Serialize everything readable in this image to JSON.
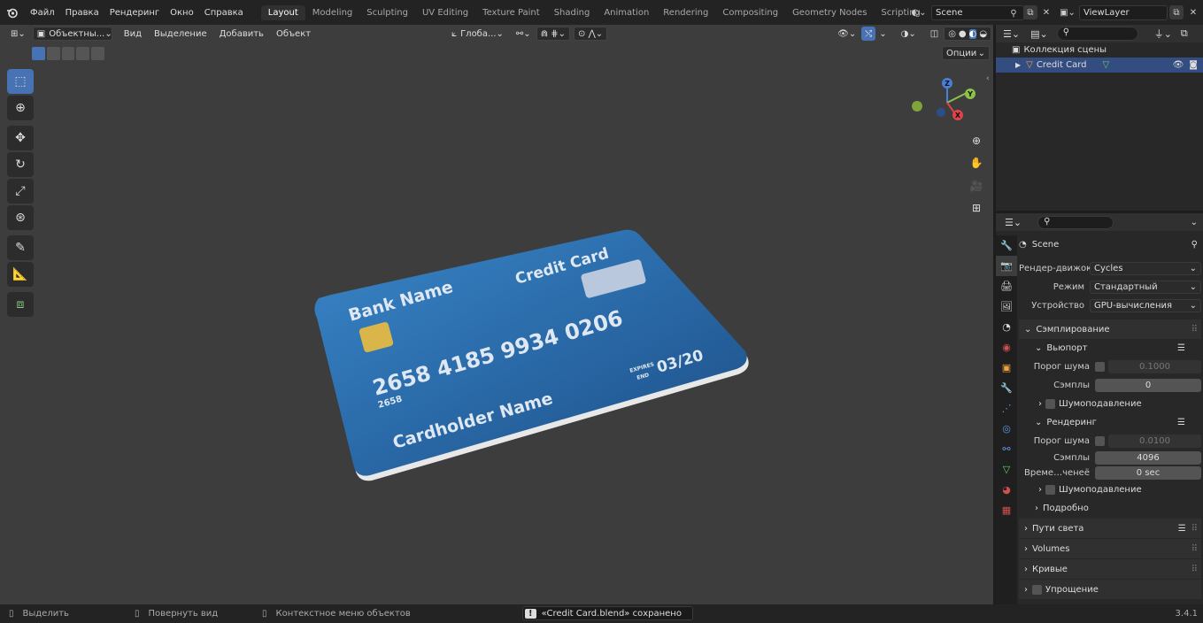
{
  "menu": {
    "items": [
      "Файл",
      "Правка",
      "Рендеринг",
      "Окно",
      "Справка"
    ]
  },
  "workspaces": {
    "tabs": [
      "Layout",
      "Modeling",
      "Sculpting",
      "UV Editing",
      "Texture Paint",
      "Shading",
      "Animation",
      "Rendering",
      "Compositing",
      "Geometry Nodes",
      "Scripting"
    ],
    "active": "Layout"
  },
  "scene": {
    "name": "Scene"
  },
  "view_layer": {
    "name": "ViewLayer"
  },
  "viewport_header": {
    "mode": "Объектны...",
    "menus": [
      "Вид",
      "Выделение",
      "Добавить",
      "Объект"
    ],
    "orientation": "Глоба...",
    "options": "Опции"
  },
  "card": {
    "bank": "Bank Name",
    "title": "Credit Card",
    "number": "2658 4185 9934 0206",
    "small_number": "2658",
    "expires_label_1": "EXPIRES",
    "expires_label_2": "END",
    "expiry": "03/20",
    "holder": "Cardholder Name",
    "color_main": "#2a6aa8",
    "color_dark": "#1c4d85"
  },
  "gizmo": {
    "x": "X",
    "y": "Y",
    "z": "Z"
  },
  "outliner": {
    "collection": "Коллекция сцены",
    "object": "Credit Card"
  },
  "properties": {
    "scene_label": "Scene",
    "render_engine_label": "Рендер-движок",
    "render_engine": "Cycles",
    "mode_label": "Режим",
    "mode": "Стандартный",
    "device_label": "Устройство",
    "device": "GPU-вычисления",
    "sampling": "Сэмплирование",
    "viewport": "Вьюпорт",
    "noise_threshold_label": "Порог шума",
    "viewport_noise": "0.1000",
    "samples_label": "Сэмплы",
    "viewport_samples": "0",
    "denoise": "Шумоподавление",
    "render": "Рендеринг",
    "render_noise": "0.0100",
    "render_samples": "4096",
    "time_limit_label": "Време…ченеё",
    "time_limit": "0 sec",
    "denoise2": "Шумоподавление",
    "advanced": "Подробно",
    "light_paths": "Пути света",
    "volumes": "Volumes",
    "curves": "Кривые",
    "simplify": "Упрощение"
  },
  "status": {
    "select": "Выделить",
    "rotate": "Повернуть вид",
    "context": "Контекстное меню объектов",
    "message": "«Credit Card.blend» сохранено",
    "version": "3.4.1"
  },
  "colors": {
    "accent": "#4772b3",
    "bg": "#3d3d3d"
  }
}
